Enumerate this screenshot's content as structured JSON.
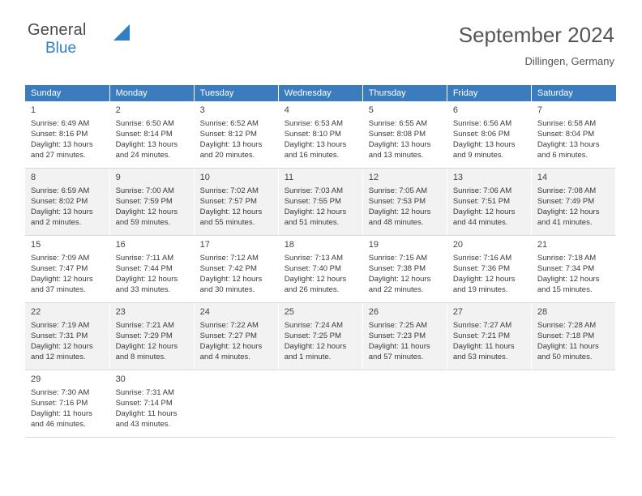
{
  "brand": {
    "name_top": "General",
    "name_bottom": "Blue",
    "mark": "blue-triangle-logo-icon",
    "accent_color": "#2f7fc1"
  },
  "header": {
    "month_title": "September 2024",
    "location": "Dillingen, Germany"
  },
  "calendar": {
    "header_bg": "#3b7cbf",
    "weekdays": [
      "Sunday",
      "Monday",
      "Tuesday",
      "Wednesday",
      "Thursday",
      "Friday",
      "Saturday"
    ],
    "weeks": [
      [
        {
          "day": "1",
          "lines": [
            "Sunrise: 6:49 AM",
            "Sunset: 8:16 PM",
            "Daylight: 13 hours",
            "and 27 minutes."
          ]
        },
        {
          "day": "2",
          "lines": [
            "Sunrise: 6:50 AM",
            "Sunset: 8:14 PM",
            "Daylight: 13 hours",
            "and 24 minutes."
          ]
        },
        {
          "day": "3",
          "lines": [
            "Sunrise: 6:52 AM",
            "Sunset: 8:12 PM",
            "Daylight: 13 hours",
            "and 20 minutes."
          ]
        },
        {
          "day": "4",
          "lines": [
            "Sunrise: 6:53 AM",
            "Sunset: 8:10 PM",
            "Daylight: 13 hours",
            "and 16 minutes."
          ]
        },
        {
          "day": "5",
          "lines": [
            "Sunrise: 6:55 AM",
            "Sunset: 8:08 PM",
            "Daylight: 13 hours",
            "and 13 minutes."
          ]
        },
        {
          "day": "6",
          "lines": [
            "Sunrise: 6:56 AM",
            "Sunset: 8:06 PM",
            "Daylight: 13 hours",
            "and 9 minutes."
          ]
        },
        {
          "day": "7",
          "lines": [
            "Sunrise: 6:58 AM",
            "Sunset: 8:04 PM",
            "Daylight: 13 hours",
            "and 6 minutes."
          ]
        }
      ],
      [
        {
          "day": "8",
          "lines": [
            "Sunrise: 6:59 AM",
            "Sunset: 8:02 PM",
            "Daylight: 13 hours",
            "and 2 minutes."
          ]
        },
        {
          "day": "9",
          "lines": [
            "Sunrise: 7:00 AM",
            "Sunset: 7:59 PM",
            "Daylight: 12 hours",
            "and 59 minutes."
          ]
        },
        {
          "day": "10",
          "lines": [
            "Sunrise: 7:02 AM",
            "Sunset: 7:57 PM",
            "Daylight: 12 hours",
            "and 55 minutes."
          ]
        },
        {
          "day": "11",
          "lines": [
            "Sunrise: 7:03 AM",
            "Sunset: 7:55 PM",
            "Daylight: 12 hours",
            "and 51 minutes."
          ]
        },
        {
          "day": "12",
          "lines": [
            "Sunrise: 7:05 AM",
            "Sunset: 7:53 PM",
            "Daylight: 12 hours",
            "and 48 minutes."
          ]
        },
        {
          "day": "13",
          "lines": [
            "Sunrise: 7:06 AM",
            "Sunset: 7:51 PM",
            "Daylight: 12 hours",
            "and 44 minutes."
          ]
        },
        {
          "day": "14",
          "lines": [
            "Sunrise: 7:08 AM",
            "Sunset: 7:49 PM",
            "Daylight: 12 hours",
            "and 41 minutes."
          ]
        }
      ],
      [
        {
          "day": "15",
          "lines": [
            "Sunrise: 7:09 AM",
            "Sunset: 7:47 PM",
            "Daylight: 12 hours",
            "and 37 minutes."
          ]
        },
        {
          "day": "16",
          "lines": [
            "Sunrise: 7:11 AM",
            "Sunset: 7:44 PM",
            "Daylight: 12 hours",
            "and 33 minutes."
          ]
        },
        {
          "day": "17",
          "lines": [
            "Sunrise: 7:12 AM",
            "Sunset: 7:42 PM",
            "Daylight: 12 hours",
            "and 30 minutes."
          ]
        },
        {
          "day": "18",
          "lines": [
            "Sunrise: 7:13 AM",
            "Sunset: 7:40 PM",
            "Daylight: 12 hours",
            "and 26 minutes."
          ]
        },
        {
          "day": "19",
          "lines": [
            "Sunrise: 7:15 AM",
            "Sunset: 7:38 PM",
            "Daylight: 12 hours",
            "and 22 minutes."
          ]
        },
        {
          "day": "20",
          "lines": [
            "Sunrise: 7:16 AM",
            "Sunset: 7:36 PM",
            "Daylight: 12 hours",
            "and 19 minutes."
          ]
        },
        {
          "day": "21",
          "lines": [
            "Sunrise: 7:18 AM",
            "Sunset: 7:34 PM",
            "Daylight: 12 hours",
            "and 15 minutes."
          ]
        }
      ],
      [
        {
          "day": "22",
          "lines": [
            "Sunrise: 7:19 AM",
            "Sunset: 7:31 PM",
            "Daylight: 12 hours",
            "and 12 minutes."
          ]
        },
        {
          "day": "23",
          "lines": [
            "Sunrise: 7:21 AM",
            "Sunset: 7:29 PM",
            "Daylight: 12 hours",
            "and 8 minutes."
          ]
        },
        {
          "day": "24",
          "lines": [
            "Sunrise: 7:22 AM",
            "Sunset: 7:27 PM",
            "Daylight: 12 hours",
            "and 4 minutes."
          ]
        },
        {
          "day": "25",
          "lines": [
            "Sunrise: 7:24 AM",
            "Sunset: 7:25 PM",
            "Daylight: 12 hours",
            "and 1 minute."
          ]
        },
        {
          "day": "26",
          "lines": [
            "Sunrise: 7:25 AM",
            "Sunset: 7:23 PM",
            "Daylight: 11 hours",
            "and 57 minutes."
          ]
        },
        {
          "day": "27",
          "lines": [
            "Sunrise: 7:27 AM",
            "Sunset: 7:21 PM",
            "Daylight: 11 hours",
            "and 53 minutes."
          ]
        },
        {
          "day": "28",
          "lines": [
            "Sunrise: 7:28 AM",
            "Sunset: 7:18 PM",
            "Daylight: 11 hours",
            "and 50 minutes."
          ]
        }
      ],
      [
        {
          "day": "29",
          "lines": [
            "Sunrise: 7:30 AM",
            "Sunset: 7:16 PM",
            "Daylight: 11 hours",
            "and 46 minutes."
          ]
        },
        {
          "day": "30",
          "lines": [
            "Sunrise: 7:31 AM",
            "Sunset: 7:14 PM",
            "Daylight: 11 hours",
            "and 43 minutes."
          ]
        },
        {
          "day": "",
          "lines": []
        },
        {
          "day": "",
          "lines": []
        },
        {
          "day": "",
          "lines": []
        },
        {
          "day": "",
          "lines": []
        },
        {
          "day": "",
          "lines": []
        }
      ]
    ]
  }
}
